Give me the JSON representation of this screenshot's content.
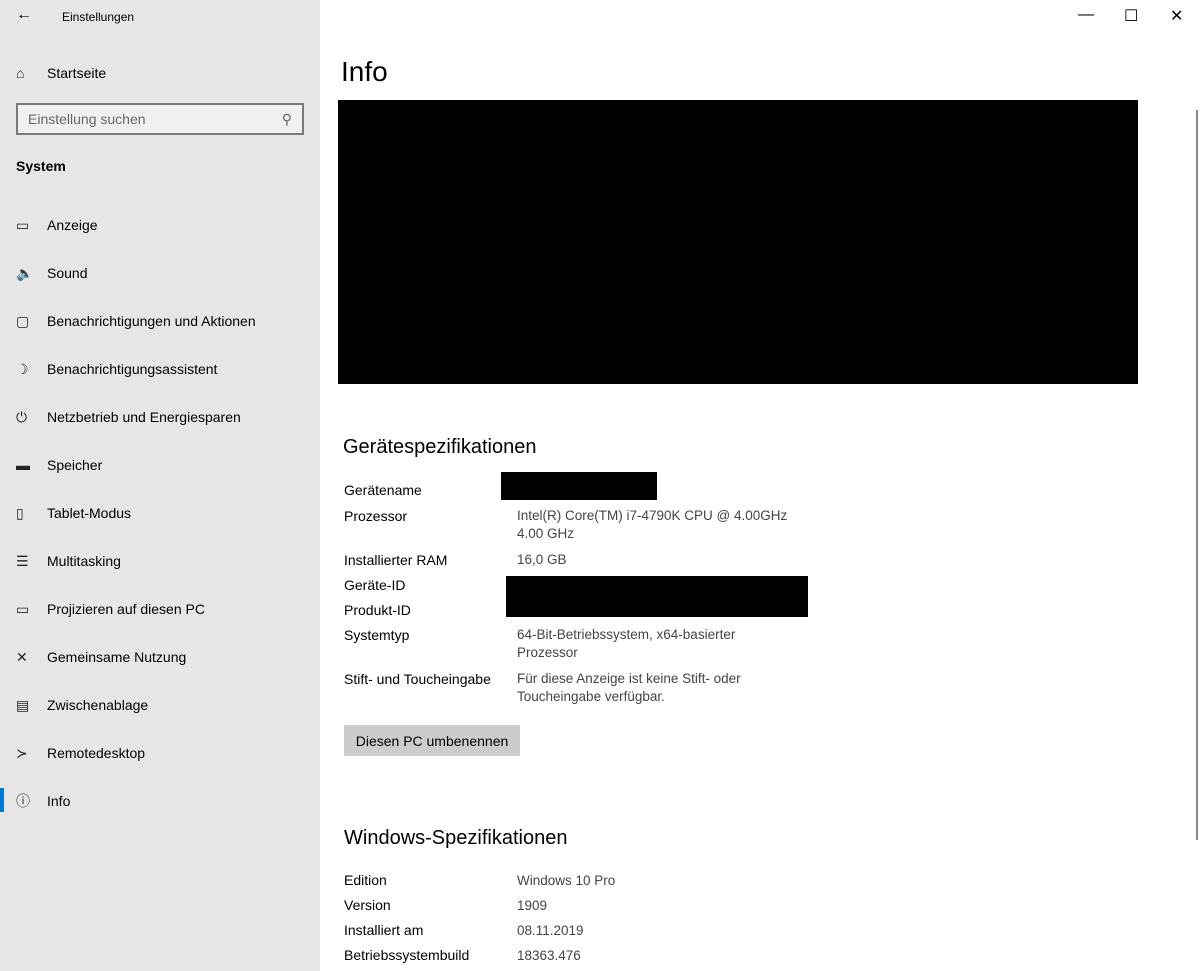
{
  "app_title": "Einstellungen",
  "home": "Startseite",
  "search_placeholder": "Einstellung suchen",
  "section": "System",
  "nav": [
    {
      "label": "Anzeige",
      "icon": "monitor-icon"
    },
    {
      "label": "Sound",
      "icon": "speaker-icon"
    },
    {
      "label": "Benachrichtigungen und Aktionen",
      "icon": "notification-icon"
    },
    {
      "label": "Benachrichtigungsassistent",
      "icon": "moon-icon"
    },
    {
      "label": "Netzbetrieb und Energiesparen",
      "icon": "power-icon"
    },
    {
      "label": "Speicher",
      "icon": "storage-icon"
    },
    {
      "label": "Tablet-Modus",
      "icon": "tablet-icon"
    },
    {
      "label": "Multitasking",
      "icon": "multitasking-icon"
    },
    {
      "label": "Projizieren auf diesen PC",
      "icon": "project-icon"
    },
    {
      "label": "Gemeinsame Nutzung",
      "icon": "share-icon"
    },
    {
      "label": "Zwischenablage",
      "icon": "clipboard-icon"
    },
    {
      "label": "Remotedesktop",
      "icon": "remote-icon"
    },
    {
      "label": "Info",
      "icon": "info-icon"
    }
  ],
  "accent": "#0078d7",
  "page_title": "Info",
  "device_specs": {
    "title": "Gerätespezifikationen",
    "rows": [
      {
        "label": "Gerätename",
        "value": ""
      },
      {
        "label": "Prozessor",
        "value": "Intel(R) Core(TM) i7-4790K CPU @ 4.00GHz",
        "value2": "4.00 GHz"
      },
      {
        "label": "Installierter RAM",
        "value": "16,0 GB"
      },
      {
        "label": "Geräte-ID",
        "value": ""
      },
      {
        "label": "Produkt-ID",
        "value": ""
      },
      {
        "label": "Systemtyp",
        "value": "64-Bit-Betriebssystem, x64-basierter",
        "value2": "Prozessor"
      },
      {
        "label": "Stift- und Toucheingabe",
        "value": "Für diese Anzeige ist keine Stift- oder",
        "value2": "Toucheingabe verfügbar."
      }
    ]
  },
  "rename_button": "Diesen PC umbenennen",
  "windows_specs": {
    "title": "Windows-Spezifikationen",
    "rows": [
      {
        "label": "Edition",
        "value": "Windows 10 Pro"
      },
      {
        "label": "Version",
        "value": "1909"
      },
      {
        "label": "Installiert am",
        "value": "08.11.2019"
      },
      {
        "label": "Betriebssystembuild",
        "value": "18363.476"
      }
    ]
  }
}
